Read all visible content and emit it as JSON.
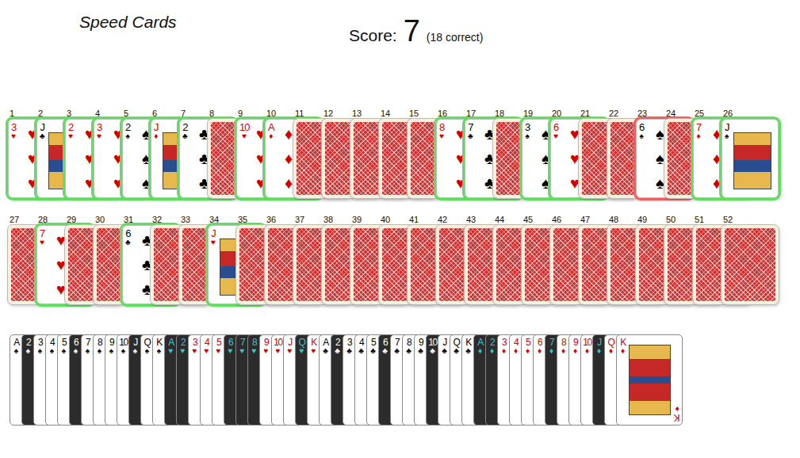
{
  "title": "Speed Cards",
  "score": {
    "label": "Score:",
    "value": "7",
    "detail": "(18 correct)"
  },
  "slots": [
    {
      "number": "1",
      "face_up": true,
      "rank": "3",
      "suit": "♥",
      "color": "#d40000",
      "kind": "pip",
      "status": "correct"
    },
    {
      "number": "2",
      "face_up": true,
      "rank": "J",
      "suit": "♣",
      "color": "#000000",
      "kind": "court",
      "status": "correct"
    },
    {
      "number": "3",
      "face_up": true,
      "rank": "2",
      "suit": "♥",
      "color": "#d40000",
      "kind": "pip",
      "status": "correct"
    },
    {
      "number": "4",
      "face_up": true,
      "rank": "3",
      "suit": "♥",
      "color": "#d40000",
      "kind": "pip",
      "status": "correct"
    },
    {
      "number": "5",
      "face_up": true,
      "rank": "2",
      "suit": "♠",
      "color": "#000000",
      "kind": "pip",
      "status": "correct"
    },
    {
      "number": "6",
      "face_up": true,
      "rank": "J",
      "suit": "♦",
      "color": "#d40000",
      "kind": "court",
      "status": "correct"
    },
    {
      "number": "7",
      "face_up": true,
      "rank": "2",
      "suit": "♣",
      "color": "#000000",
      "kind": "pip",
      "status": "correct"
    },
    {
      "number": "8",
      "face_up": false,
      "status": "none"
    },
    {
      "number": "9",
      "face_up": true,
      "rank": "10",
      "suit": "♥",
      "color": "#d40000",
      "kind": "pip",
      "status": "correct"
    },
    {
      "number": "10",
      "face_up": true,
      "rank": "A",
      "suit": "♦",
      "color": "#d40000",
      "kind": "pip",
      "status": "correct"
    },
    {
      "number": "11",
      "face_up": false,
      "status": "none"
    },
    {
      "number": "12",
      "face_up": false,
      "status": "none"
    },
    {
      "number": "13",
      "face_up": false,
      "status": "none"
    },
    {
      "number": "14",
      "face_up": false,
      "status": "none"
    },
    {
      "number": "15",
      "face_up": false,
      "status": "none"
    },
    {
      "number": "16",
      "face_up": true,
      "rank": "8",
      "suit": "♥",
      "color": "#d40000",
      "kind": "pip",
      "status": "correct"
    },
    {
      "number": "17",
      "face_up": true,
      "rank": "7",
      "suit": "♣",
      "color": "#000000",
      "kind": "pip",
      "status": "correct"
    },
    {
      "number": "18",
      "face_up": false,
      "status": "none"
    },
    {
      "number": "19",
      "face_up": true,
      "rank": "3",
      "suit": "♠",
      "color": "#000000",
      "kind": "pip",
      "status": "correct"
    },
    {
      "number": "20",
      "face_up": true,
      "rank": "6",
      "suit": "♥",
      "color": "#d40000",
      "kind": "pip",
      "status": "correct"
    },
    {
      "number": "21",
      "face_up": false,
      "status": "none"
    },
    {
      "number": "22",
      "face_up": false,
      "status": "none"
    },
    {
      "number": "23",
      "face_up": true,
      "rank": "6",
      "suit": "♠",
      "color": "#000000",
      "kind": "pip",
      "status": "wrong"
    },
    {
      "number": "24",
      "face_up": false,
      "status": "none"
    },
    {
      "number": "25",
      "face_up": true,
      "rank": "7",
      "suit": "♦",
      "color": "#d40000",
      "kind": "pip",
      "status": "correct"
    },
    {
      "number": "26",
      "face_up": true,
      "rank": "J",
      "suit": "♠",
      "color": "#000000",
      "kind": "court",
      "status": "correct"
    },
    {
      "number": "27",
      "face_up": false,
      "status": "none"
    },
    {
      "number": "28",
      "face_up": true,
      "rank": "7",
      "suit": "♥",
      "color": "#d40000",
      "kind": "pip",
      "status": "correct"
    },
    {
      "number": "29",
      "face_up": false,
      "status": "none"
    },
    {
      "number": "30",
      "face_up": false,
      "status": "none"
    },
    {
      "number": "31",
      "face_up": true,
      "rank": "6",
      "suit": "♣",
      "color": "#000000",
      "kind": "pip",
      "status": "correct"
    },
    {
      "number": "32",
      "face_up": false,
      "status": "none"
    },
    {
      "number": "33",
      "face_up": false,
      "status": "none"
    },
    {
      "number": "34",
      "face_up": true,
      "rank": "J",
      "suit": "♥",
      "color": "#d40000",
      "kind": "court",
      "status": "correct"
    },
    {
      "number": "35",
      "face_up": false,
      "status": "none"
    },
    {
      "number": "36",
      "face_up": false,
      "status": "none"
    },
    {
      "number": "37",
      "face_up": false,
      "status": "none"
    },
    {
      "number": "38",
      "face_up": false,
      "status": "none"
    },
    {
      "number": "39",
      "face_up": false,
      "status": "none"
    },
    {
      "number": "40",
      "face_up": false,
      "status": "none"
    },
    {
      "number": "41",
      "face_up": false,
      "status": "none"
    },
    {
      "number": "42",
      "face_up": false,
      "status": "none"
    },
    {
      "number": "43",
      "face_up": false,
      "status": "none"
    },
    {
      "number": "44",
      "face_up": false,
      "status": "none"
    },
    {
      "number": "45",
      "face_up": false,
      "status": "none"
    },
    {
      "number": "46",
      "face_up": false,
      "status": "none"
    },
    {
      "number": "47",
      "face_up": false,
      "status": "none"
    },
    {
      "number": "48",
      "face_up": false,
      "status": "none"
    },
    {
      "number": "49",
      "face_up": false,
      "status": "none"
    },
    {
      "number": "50",
      "face_up": false,
      "status": "none"
    },
    {
      "number": "51",
      "face_up": false,
      "status": "none"
    },
    {
      "number": "52",
      "face_up": false,
      "status": "none"
    }
  ],
  "picker": [
    {
      "rank": "A",
      "suit": "♠",
      "color": "#000000",
      "dimmed": false
    },
    {
      "rank": "2",
      "suit": "♠",
      "color": "#000000",
      "dimmed": true
    },
    {
      "rank": "3",
      "suit": "♠",
      "color": "#000000",
      "dimmed": false
    },
    {
      "rank": "4",
      "suit": "♠",
      "color": "#000000",
      "dimmed": false
    },
    {
      "rank": "5",
      "suit": "♠",
      "color": "#000000",
      "dimmed": false
    },
    {
      "rank": "6",
      "suit": "♠",
      "color": "#000000",
      "dimmed": true
    },
    {
      "rank": "7",
      "suit": "♠",
      "color": "#000000",
      "dimmed": false
    },
    {
      "rank": "8",
      "suit": "♠",
      "color": "#000000",
      "dimmed": false
    },
    {
      "rank": "9",
      "suit": "♠",
      "color": "#000000",
      "dimmed": false
    },
    {
      "rank": "10",
      "suit": "♠",
      "color": "#000000",
      "dimmed": false
    },
    {
      "rank": "J",
      "suit": "♠",
      "color": "#000000",
      "dimmed": true
    },
    {
      "rank": "Q",
      "suit": "♠",
      "color": "#000000",
      "dimmed": false
    },
    {
      "rank": "K",
      "suit": "♠",
      "color": "#000000",
      "dimmed": false
    },
    {
      "rank": "A",
      "suit": "♥",
      "color": "#d40000",
      "dimmed": true
    },
    {
      "rank": "2",
      "suit": "♥",
      "color": "#d40000",
      "dimmed": true
    },
    {
      "rank": "3",
      "suit": "♥",
      "color": "#d40000",
      "dimmed": false
    },
    {
      "rank": "4",
      "suit": "♥",
      "color": "#d40000",
      "dimmed": false
    },
    {
      "rank": "5",
      "suit": "♥",
      "color": "#d40000",
      "dimmed": false
    },
    {
      "rank": "6",
      "suit": "♥",
      "color": "#d40000",
      "dimmed": true
    },
    {
      "rank": "7",
      "suit": "♥",
      "color": "#d40000",
      "dimmed": true
    },
    {
      "rank": "8",
      "suit": "♥",
      "color": "#d40000",
      "dimmed": true
    },
    {
      "rank": "9",
      "suit": "♥",
      "color": "#d40000",
      "dimmed": false
    },
    {
      "rank": "10",
      "suit": "♥",
      "color": "#d40000",
      "dimmed": false
    },
    {
      "rank": "J",
      "suit": "♥",
      "color": "#d40000",
      "dimmed": false
    },
    {
      "rank": "Q",
      "suit": "♥",
      "color": "#d40000",
      "dimmed": true
    },
    {
      "rank": "K",
      "suit": "♥",
      "color": "#d40000",
      "dimmed": false
    },
    {
      "rank": "A",
      "suit": "♣",
      "color": "#000000",
      "dimmed": false
    },
    {
      "rank": "2",
      "suit": "♣",
      "color": "#000000",
      "dimmed": true
    },
    {
      "rank": "3",
      "suit": "♣",
      "color": "#000000",
      "dimmed": false
    },
    {
      "rank": "4",
      "suit": "♣",
      "color": "#000000",
      "dimmed": false
    },
    {
      "rank": "5",
      "suit": "♣",
      "color": "#000000",
      "dimmed": false
    },
    {
      "rank": "6",
      "suit": "♣",
      "color": "#000000",
      "dimmed": true
    },
    {
      "rank": "7",
      "suit": "♣",
      "color": "#000000",
      "dimmed": false
    },
    {
      "rank": "8",
      "suit": "♣",
      "color": "#000000",
      "dimmed": false
    },
    {
      "rank": "9",
      "suit": "♣",
      "color": "#000000",
      "dimmed": false
    },
    {
      "rank": "10",
      "suit": "♣",
      "color": "#000000",
      "dimmed": true
    },
    {
      "rank": "J",
      "suit": "♣",
      "color": "#000000",
      "dimmed": false
    },
    {
      "rank": "Q",
      "suit": "♣",
      "color": "#000000",
      "dimmed": false
    },
    {
      "rank": "K",
      "suit": "♣",
      "color": "#000000",
      "dimmed": false
    },
    {
      "rank": "A",
      "suit": "♦",
      "color": "#d40000",
      "dimmed": true
    },
    {
      "rank": "2",
      "suit": "♦",
      "color": "#d40000",
      "dimmed": true
    },
    {
      "rank": "3",
      "suit": "♦",
      "color": "#d40000",
      "dimmed": false
    },
    {
      "rank": "4",
      "suit": "♦",
      "color": "#d40000",
      "dimmed": false
    },
    {
      "rank": "5",
      "suit": "♦",
      "color": "#d40000",
      "dimmed": false
    },
    {
      "rank": "6",
      "suit": "♦",
      "color": "#d40000",
      "dimmed": false
    },
    {
      "rank": "7",
      "suit": "♦",
      "color": "#d40000",
      "dimmed": true
    },
    {
      "rank": "8",
      "suit": "♦",
      "color": "#d40000",
      "dimmed": false
    },
    {
      "rank": "9",
      "suit": "♦",
      "color": "#d40000",
      "dimmed": false
    },
    {
      "rank": "10",
      "suit": "♦",
      "color": "#d40000",
      "dimmed": false
    },
    {
      "rank": "J",
      "suit": "♦",
      "color": "#d40000",
      "dimmed": true
    },
    {
      "rank": "Q",
      "suit": "♦",
      "color": "#d40000",
      "dimmed": false
    },
    {
      "rank": "K",
      "suit": "♦",
      "color": "#d40000",
      "dimmed": false
    }
  ]
}
